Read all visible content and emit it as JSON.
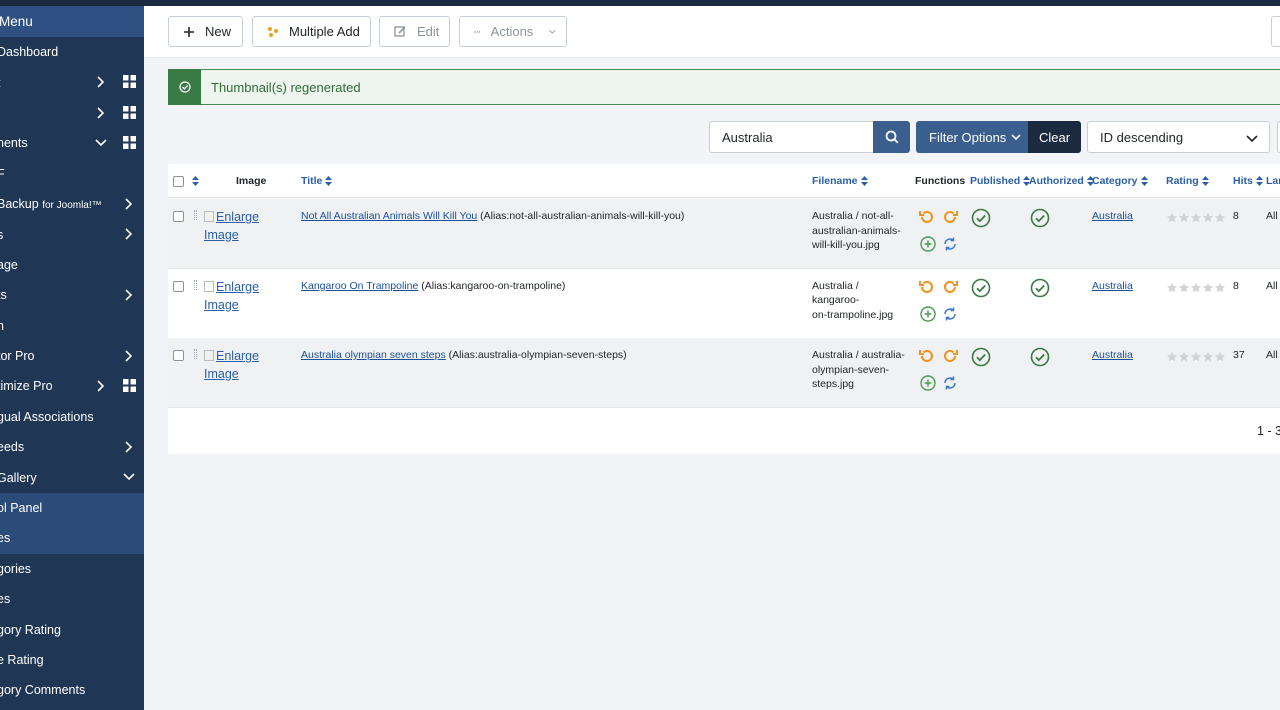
{
  "sidebar": {
    "menu_title": "Menu",
    "items": [
      {
        "label": "Dashboard",
        "chev": false,
        "grid": false,
        "active": false
      },
      {
        "label": "t",
        "chev": "right",
        "grid": true,
        "active": false
      },
      {
        "label": "",
        "chev": "right",
        "grid": true,
        "active": false
      },
      {
        "label": "nents",
        "chev": "down",
        "grid": true,
        "active": false
      },
      {
        "label": "F",
        "chev": false,
        "grid": false,
        "active": false
      },
      {
        "label": " Backup",
        "small": "for Joomla!™",
        "chev": "right2",
        "grid": false,
        "active": false
      },
      {
        "label": "s",
        "chev": "right2",
        "grid": false,
        "active": false
      },
      {
        "label": "age",
        "chev": false,
        "grid": false,
        "active": false
      },
      {
        "label": "ts",
        "chev": "right2",
        "grid": false,
        "active": false
      },
      {
        "label": "h",
        "chev": false,
        "grid": false,
        "active": false
      },
      {
        "label": "tor Pro",
        "chev": "right2",
        "grid": false,
        "active": false
      },
      {
        "label": "timize Pro",
        "chev": "right",
        "grid": true,
        "active": false
      },
      {
        "label": "gual Associations",
        "chev": false,
        "grid": false,
        "active": false
      },
      {
        "label": "eeds",
        "chev": "right2",
        "grid": false,
        "active": false
      },
      {
        "label": "Gallery",
        "chev": "down2",
        "grid": false,
        "active": false
      },
      {
        "label": "ol Panel",
        "chev": false,
        "grid": false,
        "active": true
      },
      {
        "label": "es",
        "chev": false,
        "grid": false,
        "active": true
      },
      {
        "label": "gories",
        "chev": false,
        "grid": false,
        "active": false
      },
      {
        "label": "es",
        "chev": false,
        "grid": false,
        "active": false
      },
      {
        "label": "gory Rating",
        "chev": false,
        "grid": false,
        "active": false
      },
      {
        "label": "e Rating",
        "chev": false,
        "grid": false,
        "active": false
      },
      {
        "label": "gory Comments",
        "chev": false,
        "grid": false,
        "active": false
      }
    ]
  },
  "toolbar": {
    "new_label": "New",
    "multiple_add_label": "Multiple Add",
    "edit_label": "Edit",
    "actions_label": "Actions"
  },
  "alert": {
    "message": "Thumbnail(s) regenerated"
  },
  "filters": {
    "search_value": "Australia",
    "filter_options_label": "Filter Options",
    "clear_label": "Clear",
    "sort_value": "ID descending"
  },
  "table": {
    "headers": {
      "image": "Image",
      "title": "Title",
      "filename": "Filename",
      "functions": "Functions",
      "published": "Published",
      "authorized": "Authorized",
      "category": "Category",
      "rating": "Rating",
      "hits": "Hits",
      "language": "Lan"
    },
    "rows": [
      {
        "image_alt_1": "Enlarge",
        "image_alt_2": "Image",
        "title": "Not All Australian Animals Will Kill You",
        "alias": "(Alias:not-all-australian-animals-will-kill-you)",
        "filename_lines": [
          "Australia / not-all-",
          "australian-animals-",
          "will-kill-you.jpg"
        ],
        "category": "Australia",
        "hits": "8",
        "language": "All"
      },
      {
        "image_alt_1": "Enlarge",
        "image_alt_2": "Image",
        "title": "Kangaroo On Trampoline",
        "alias": "(Alias:kangaroo-on-trampoline)",
        "filename_lines": [
          "Australia / kangaroo-",
          "on-trampoline.jpg",
          ""
        ],
        "category": "Australia",
        "hits": "8",
        "language": "All"
      },
      {
        "image_alt_1": "Enlarge",
        "image_alt_2": "Image",
        "title": "Australia olympian seven steps",
        "alias": "(Alias:australia-olympian-seven-steps)",
        "filename_lines": [
          "Australia / australia-",
          "olympian-seven-",
          "steps.jpg"
        ],
        "category": "Australia",
        "hits": "37",
        "language": "All"
      }
    ],
    "pagination": "1 - 3"
  },
  "colors": {
    "sidebar_bg": "#1f3655",
    "accent_blue": "#3a5f8f",
    "success_green": "#3a7a45",
    "function_orange": "#f0921e"
  }
}
